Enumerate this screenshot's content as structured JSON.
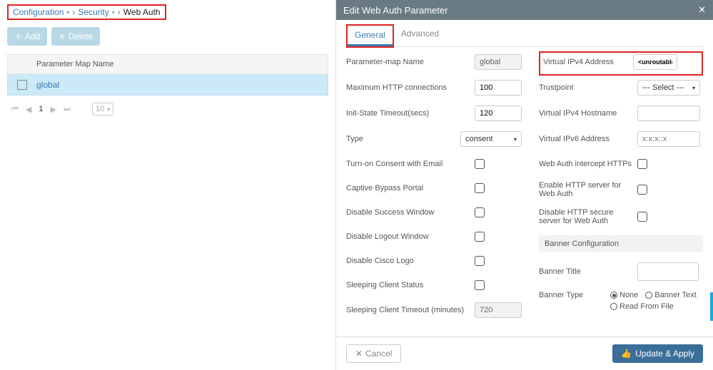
{
  "breadcrumb": {
    "item1": "Configuration",
    "item2": "Security",
    "current": "Web Auth"
  },
  "actions": {
    "add": "Add",
    "delete": "Delete"
  },
  "table": {
    "header": "Parameter Map Name",
    "row1": "global"
  },
  "pager": {
    "current": "1",
    "size": "10"
  },
  "panel": {
    "title": "Edit Web Auth Parameter",
    "tabs": {
      "general": "General",
      "advanced": "Advanced"
    },
    "left": {
      "param_name_label": "Parameter-map Name",
      "param_name_value": "global",
      "max_http_label": "Maximum HTTP connections",
      "max_http_value": "100",
      "init_timeout_label": "Init-State Timeout(secs)",
      "init_timeout_value": "120",
      "type_label": "Type",
      "type_value": "consent",
      "consent_email_label": "Turn-on Consent with Email",
      "captive_label": "Captive Bypass Portal",
      "disable_success_label": "Disable Success Window",
      "disable_logout_label": "Disable Logout Window",
      "disable_logo_label": "Disable Cisco Logo",
      "sleeping_status_label": "Sleeping Client Status",
      "sleeping_timeout_label": "Sleeping Client Timeout (minutes)",
      "sleeping_timeout_value": "720"
    },
    "right": {
      "vip4_label": "Virtual IPv4 Address",
      "vip4_value": "<unroutable-ip>",
      "trustpoint_label": "Trustpoint",
      "trustpoint_value": "--- Select ---",
      "vip4host_label": "Virtual IPv4 Hostname",
      "vip4host_value": "",
      "vip6_label": "Virtual IPv6 Address",
      "vip6_placeholder": "x:x:x::x",
      "intercept_label": "Web Auth intercept HTTPs",
      "enable_http_label": "Enable HTTP server for Web Auth",
      "disable_https_label": "Disable HTTP secure server for Web Auth",
      "banner_header": "Banner Configuration",
      "banner_title_label": "Banner Title",
      "banner_type_label": "Banner Type",
      "banner_opts": {
        "none": "None",
        "text": "Banner Text",
        "file": "Read From File"
      }
    },
    "footer": {
      "cancel": "Cancel",
      "apply": "Update & Apply"
    }
  }
}
